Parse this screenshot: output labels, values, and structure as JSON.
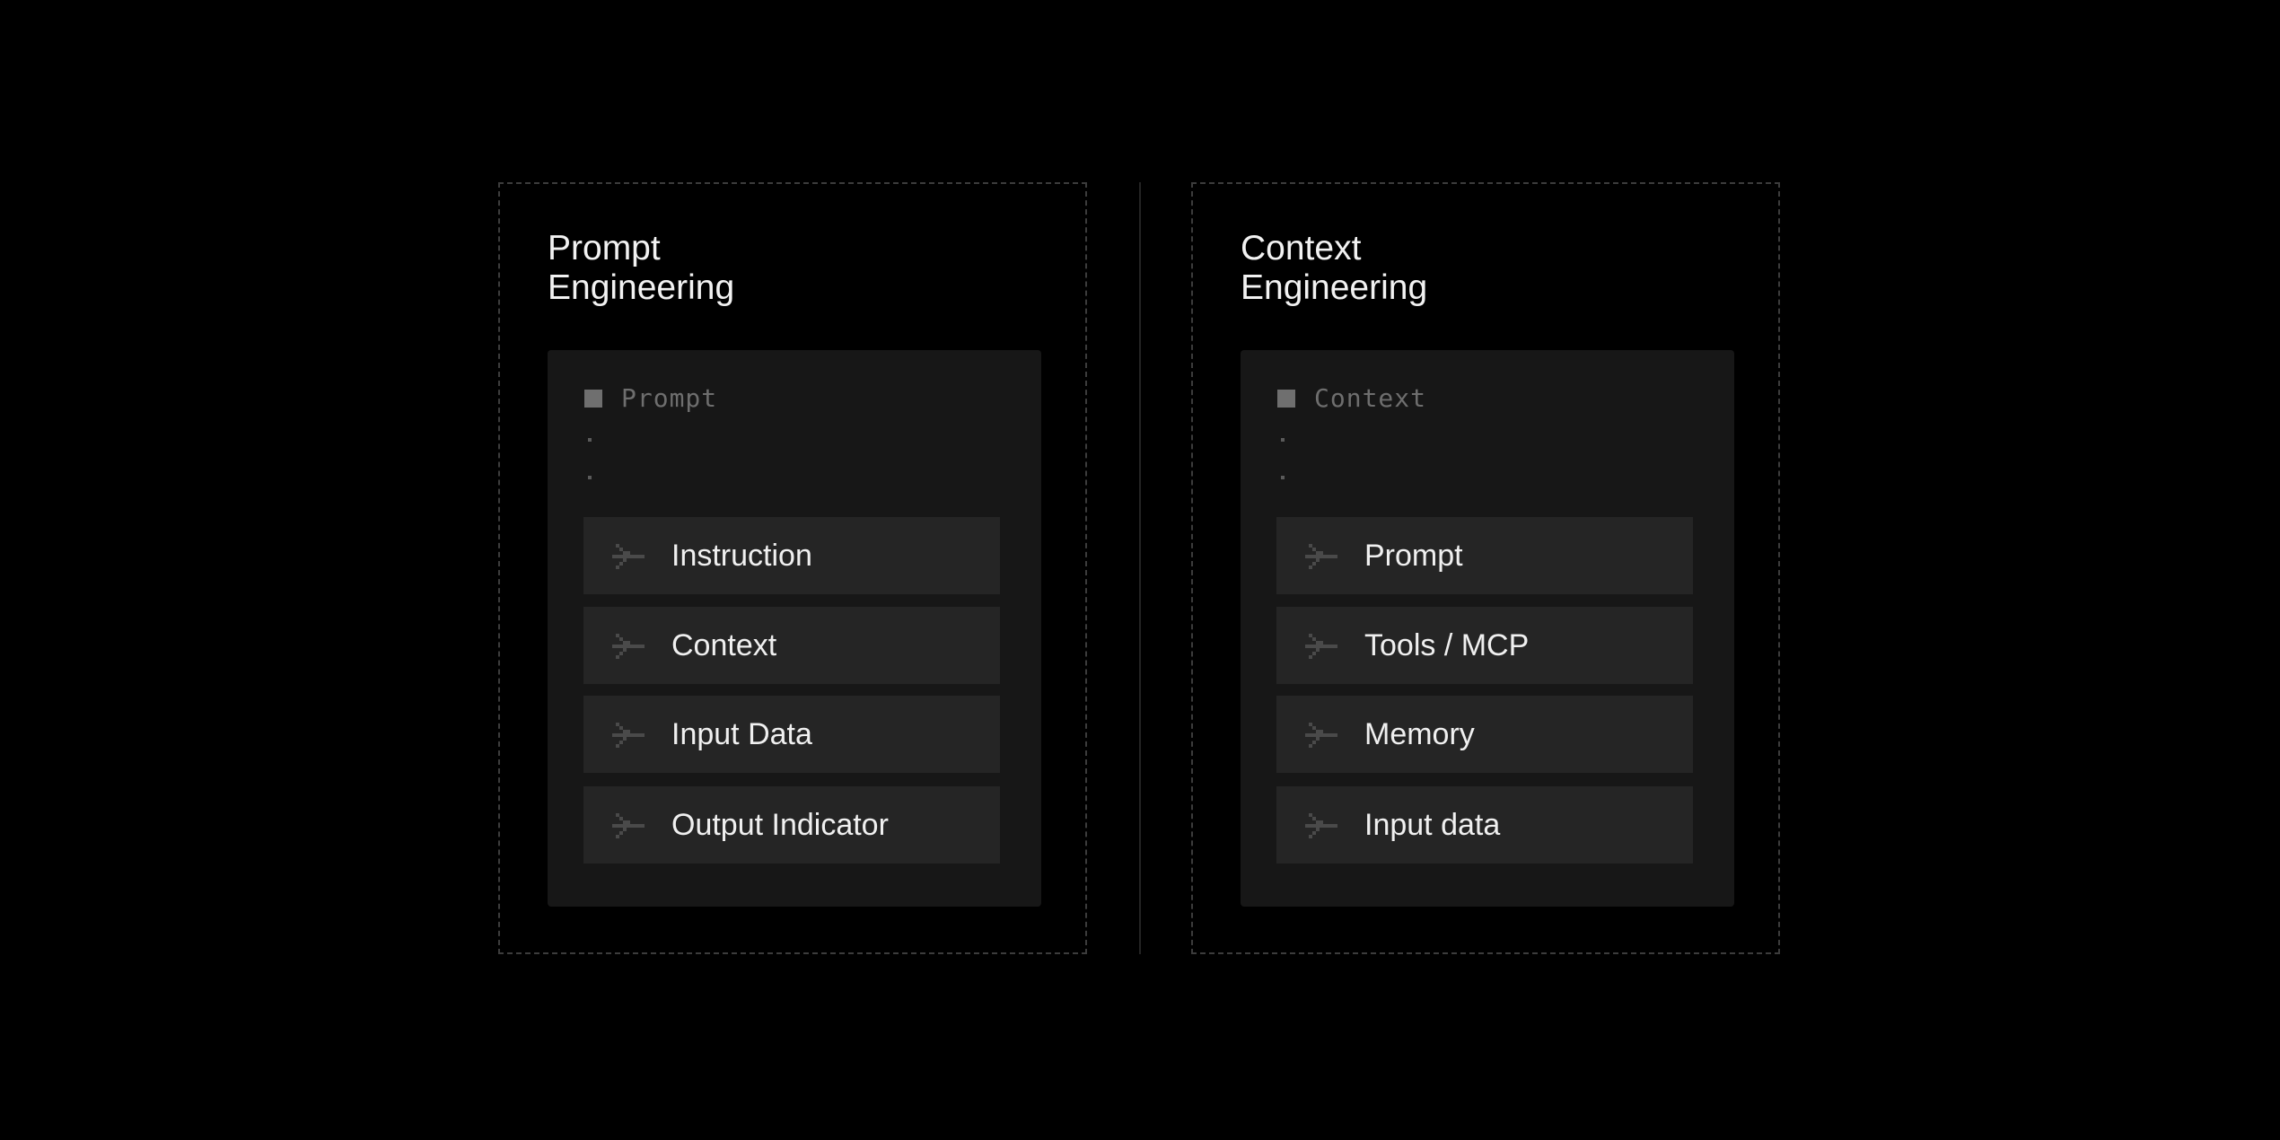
{
  "left_panel": {
    "title_line1": "Prompt",
    "title_line2": "Engineering",
    "card_label": "Prompt",
    "items": [
      {
        "label": "Instruction"
      },
      {
        "label": "Context"
      },
      {
        "label": "Input Data"
      },
      {
        "label": "Output Indicator"
      }
    ]
  },
  "right_panel": {
    "title_line1": "Context",
    "title_line2": "Engineering",
    "card_label": "Context",
    "items": [
      {
        "label": "Prompt"
      },
      {
        "label": "Tools / MCP"
      },
      {
        "label": "Memory"
      },
      {
        "label": "Input data"
      }
    ]
  },
  "icons": {
    "card_marker": "square-icon",
    "item_marker": "pixel-arrow-icon"
  },
  "colors": {
    "background": "#000000",
    "card": "#171717",
    "item": "#252525",
    "title_text": "#f2f2f2",
    "muted_text": "#6e6e6e",
    "arrow": "#4a4a4a",
    "dashed_border": "#3c3c3c"
  }
}
